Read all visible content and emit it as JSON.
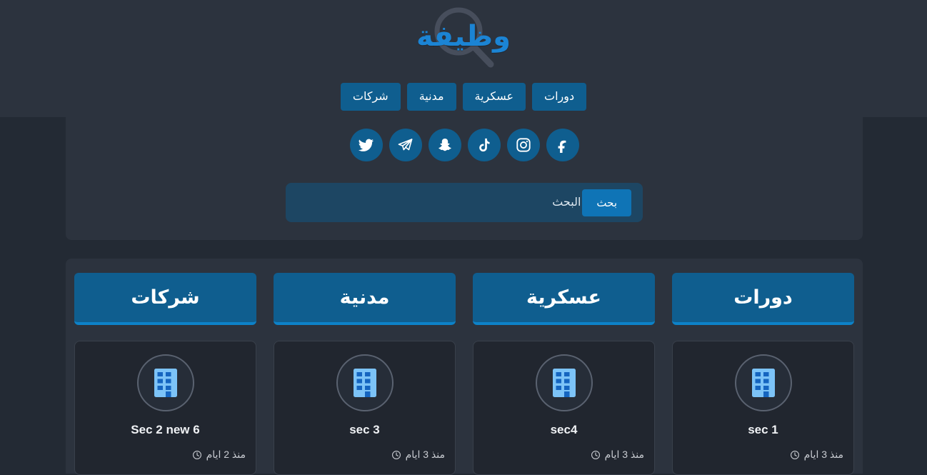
{
  "header": {
    "logo_text": "وظيفة",
    "logo_icon": "magnifier-icon",
    "nav_items": [
      {
        "label": "شركات",
        "name": "nav-companies"
      },
      {
        "label": "مدنية",
        "name": "nav-civil"
      },
      {
        "label": "عسكرية",
        "name": "nav-military"
      },
      {
        "label": "دورات",
        "name": "nav-courses"
      }
    ]
  },
  "social": {
    "items": [
      {
        "label": "twitter",
        "icon": "twitter-icon"
      },
      {
        "label": "telegram",
        "icon": "telegram-icon"
      },
      {
        "label": "snapchat",
        "icon": "snapchat-icon"
      },
      {
        "label": "tiktok",
        "icon": "tiktok-icon"
      },
      {
        "label": "instagram",
        "icon": "instagram-icon"
      },
      {
        "label": "facebook",
        "icon": "facebook-icon"
      }
    ]
  },
  "search": {
    "placeholder": "البحث",
    "value": "",
    "button_label": "بحث"
  },
  "categories": [
    {
      "header": "شركات",
      "card": {
        "title": "Sec 2 new 6",
        "time": "منذ 2 ايام",
        "icon": "building-icon",
        "time_icon": "clock-icon"
      }
    },
    {
      "header": "مدنية",
      "card": {
        "title": "sec 3",
        "time": "منذ 3 ايام",
        "icon": "building-icon",
        "time_icon": "clock-icon"
      }
    },
    {
      "header": "عسكرية",
      "card": {
        "title": "sec4",
        "time": "منذ 3 ايام",
        "icon": "building-icon",
        "time_icon": "clock-icon"
      }
    },
    {
      "header": "دورات",
      "card": {
        "title": "sec 1",
        "time": "منذ 3 ايام",
        "icon": "building-icon",
        "time_icon": "clock-icon"
      }
    }
  ],
  "colors": {
    "page_bg": "#232a34",
    "panel_bg": "#2c333e",
    "card_bg": "#21262f",
    "accent_blue": "#0f5e8f",
    "accent_blue_bright": "#0d82c8",
    "logo_blue": "#1b84d4",
    "search_bg": "#1d4663",
    "building_light": "#7cc3f7",
    "building_dark": "#1565c0"
  }
}
